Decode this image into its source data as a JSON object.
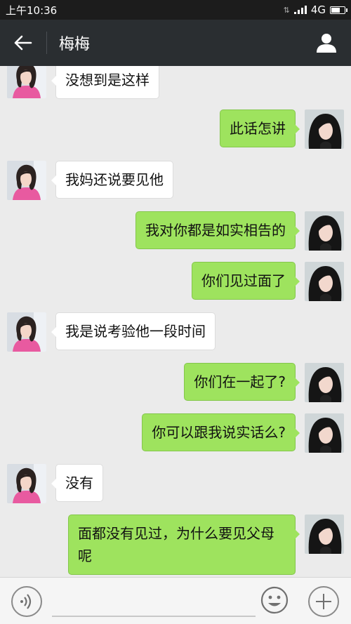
{
  "status_bar": {
    "time": "上午10:36",
    "network": "4G"
  },
  "header": {
    "title": "梅梅"
  },
  "messages": [
    {
      "side": "in",
      "text": "没想到是这样"
    },
    {
      "side": "out",
      "text": "此话怎讲"
    },
    {
      "side": "in",
      "text": "我妈还说要见他"
    },
    {
      "side": "out",
      "text": "我对你都是如实相告的"
    },
    {
      "side": "out",
      "text": "你们见过面了"
    },
    {
      "side": "in",
      "text": "我是说考验他一段时间"
    },
    {
      "side": "out",
      "text": "你们在一起了?"
    },
    {
      "side": "out",
      "text": "你可以跟我说实话么?"
    },
    {
      "side": "in",
      "text": "没有"
    },
    {
      "side": "out",
      "text": "面都没有见过，为什么要见父母呢"
    }
  ],
  "input_bar": {
    "value": "",
    "placeholder": ""
  },
  "colors": {
    "outgoing_bubble": "#9ee35e",
    "incoming_bubble": "#ffffff",
    "header_bg": "#2a2e31"
  }
}
